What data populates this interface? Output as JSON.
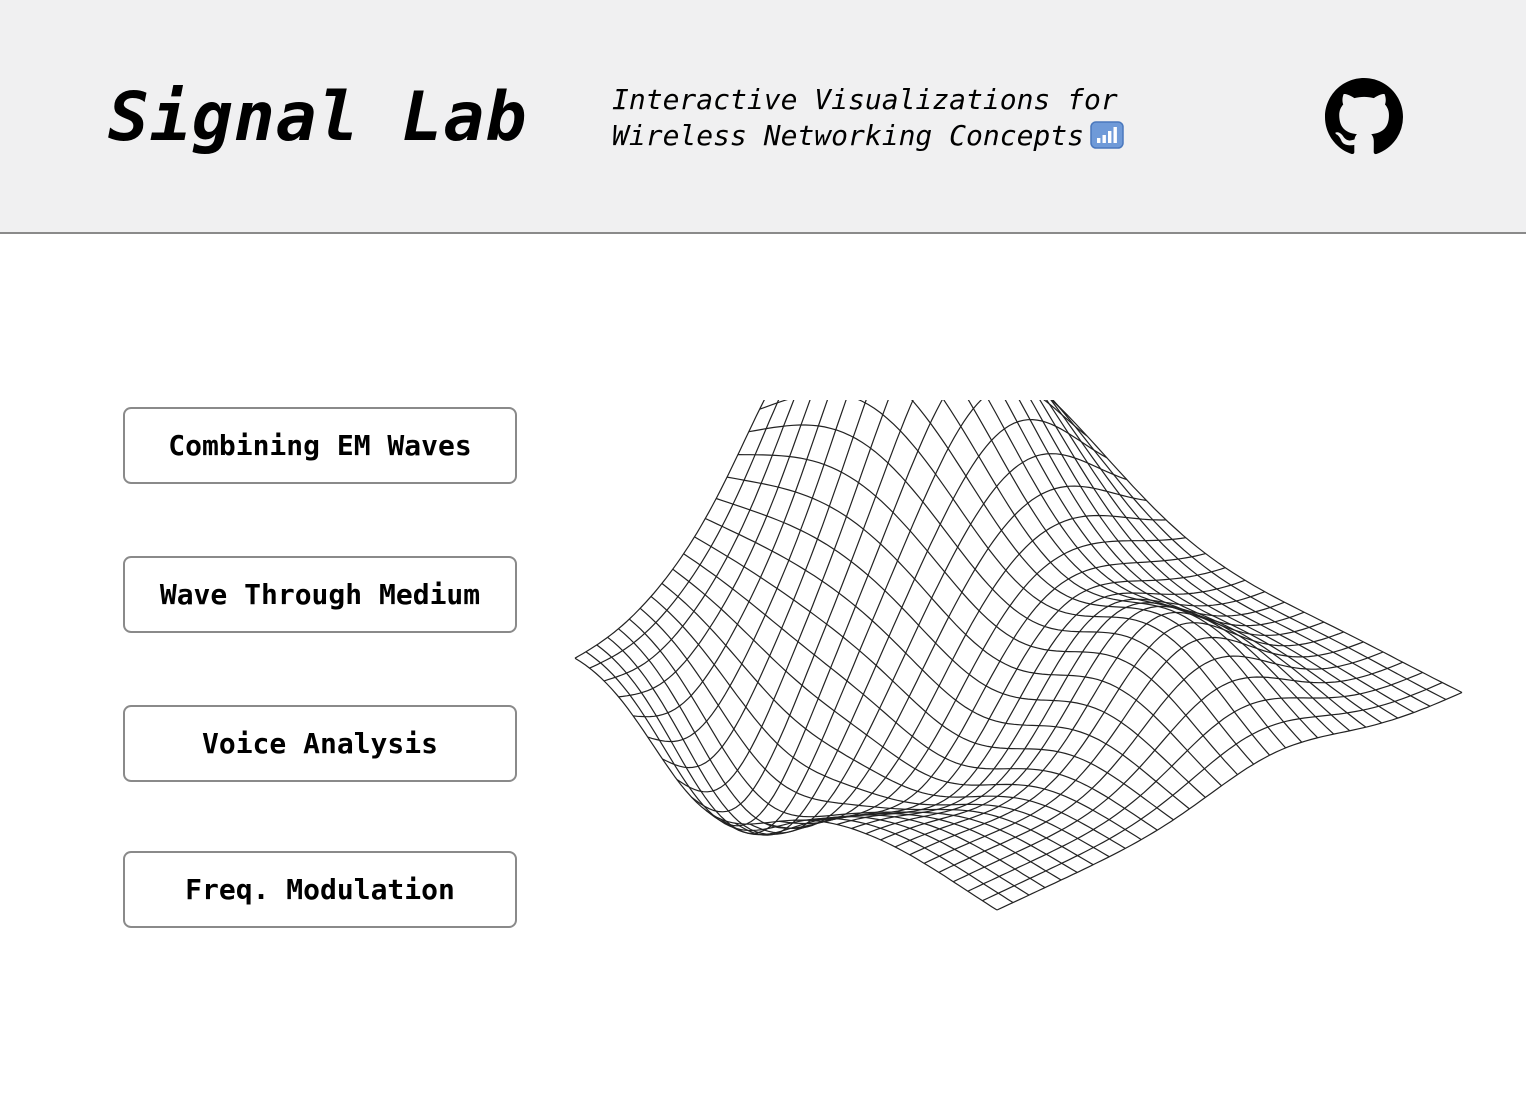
{
  "header": {
    "title": "Signal Lab",
    "subtitle_line1": "Interactive Visualizations for",
    "subtitle_line2": "Wireless Networking Concepts",
    "subtitle_icon": "signal-bars-icon",
    "github_icon": "github-icon"
  },
  "nav": {
    "buttons": [
      {
        "label": "Combining EM Waves"
      },
      {
        "label": "Wave Through Medium"
      },
      {
        "label": "Voice Analysis"
      },
      {
        "label": "Freq. Modulation"
      }
    ]
  },
  "hero": {
    "graphic": "wireframe-wave-surface"
  },
  "colors": {
    "header_bg": "#f0f0f1",
    "border": "#8a8a8a",
    "text": "#000000",
    "signal_icon_bg": "#5b8fd6"
  }
}
